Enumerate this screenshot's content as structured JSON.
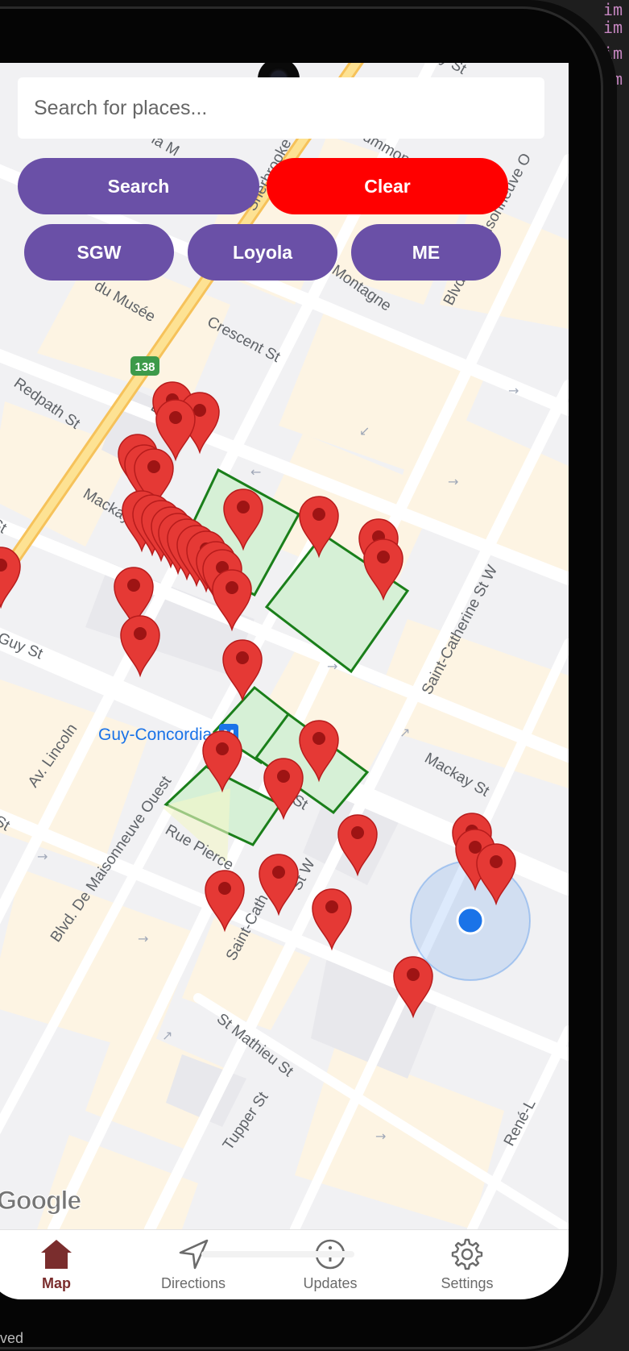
{
  "search": {
    "placeholder": "Search for places..."
  },
  "buttons": {
    "search_label": "Search",
    "clear_label": "Clear",
    "sgw_label": "SGW",
    "loyola_label": "Loyola",
    "me_label": "ME"
  },
  "colors": {
    "purple": "#6a50a7",
    "red": "#ff0000",
    "marker": "#e53935",
    "building_fill": "#d6f0d6",
    "building_stroke": "#1a7f1a",
    "user_location": "#1a73e8",
    "active_nav": "#7a2d2d"
  },
  "map": {
    "metro_label": "Guy-Concordia",
    "metro_icon": "metro-icon",
    "highway_shield": "138",
    "streets": [
      "Crescent St",
      "Redpath St",
      "Guy St",
      "Mackay St",
      "Saint-Catherine St W",
      "Blvd. De Maisonneuve Ouest",
      "Rue Pierce",
      "Av. Lincoln",
      "St Mathieu St",
      "Tupper St",
      "Montagne",
      "du Musée",
      "de la M",
      "Sherbrooke St W",
      "Drummond",
      "Saint-Cath",
      "St W",
      "René-L",
      "Blvd. De Maisonneuve O",
      "St",
      "y St",
      "B",
      "St",
      "St",
      "Blvd."
    ],
    "attribution": "Google"
  },
  "nav": {
    "items": [
      {
        "label": "Map",
        "icon": "home-icon",
        "active": true
      },
      {
        "label": "Directions",
        "icon": "navigation-arrow-icon",
        "active": false
      },
      {
        "label": "Updates",
        "icon": "info-icon",
        "active": false
      },
      {
        "label": "Settings",
        "icon": "gear-icon",
        "active": false
      }
    ]
  },
  "background": {
    "status_text": "ved"
  }
}
